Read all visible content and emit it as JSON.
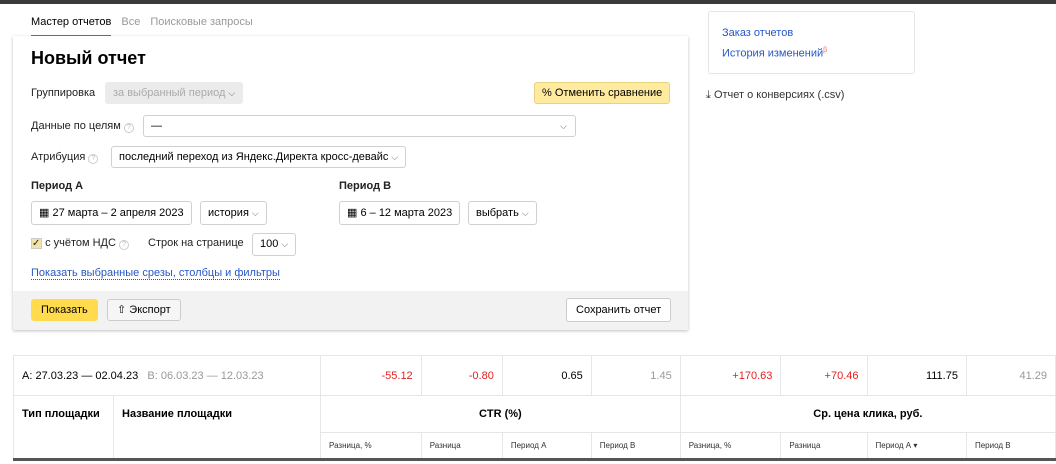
{
  "tabs": [
    "Мастер отчетов",
    "Все",
    "Поисковые запросы"
  ],
  "title": "Новый отчет",
  "grouping": {
    "label": "Группировка",
    "value": "за выбранный период"
  },
  "cancel_compare": "Отменить сравнение",
  "goals": {
    "label": "Данные по целям",
    "value": "—"
  },
  "attribution": {
    "label": "Атрибуция",
    "value": "последний переход из Яндекс.Директа кросс-девайс"
  },
  "period_a": {
    "label": "Период А",
    "dates": "27 марта – 2 апреля 2023",
    "mode": "история"
  },
  "period_b": {
    "label": "Период В",
    "dates": "6 – 12 марта 2023",
    "mode": "выбрать"
  },
  "vat": {
    "label": "с учётом НДС",
    "checked": true
  },
  "rows": {
    "label": "Строк на странице",
    "value": "100"
  },
  "show_link": "Показать выбранные срезы, столбцы и фильтры",
  "footer": {
    "show": "Показать",
    "export": "Экспорт",
    "save": "Сохранить отчет"
  },
  "side": {
    "order": "Заказ отчетов",
    "history": "История изменений",
    "beta": "β",
    "csv": "Отчет о конверсиях (.csv)"
  },
  "table": {
    "summary_a": "А: 27.03.23 — 02.04.23",
    "summary_b": "В: 06.03.23 — 12.03.23",
    "summary_values": [
      "-55.12",
      "-0.80",
      "0.65",
      "1.45",
      "+170.63",
      "+70.46",
      "111.75",
      "41.29"
    ],
    "col_type": "Тип площадки",
    "col_name": "Название площадки",
    "group_ctr": "CTR (%)",
    "group_cpc": "Ср. цена клика, руб.",
    "sub": [
      "Разница, %",
      "Разница",
      "Период А",
      "Период В",
      "Разница, %",
      "Разница",
      "Период А ▾",
      "Период В"
    ]
  },
  "colors": {
    "accent": "#ffdb4d",
    "link": "#2656c5",
    "negative": "#e52020"
  }
}
